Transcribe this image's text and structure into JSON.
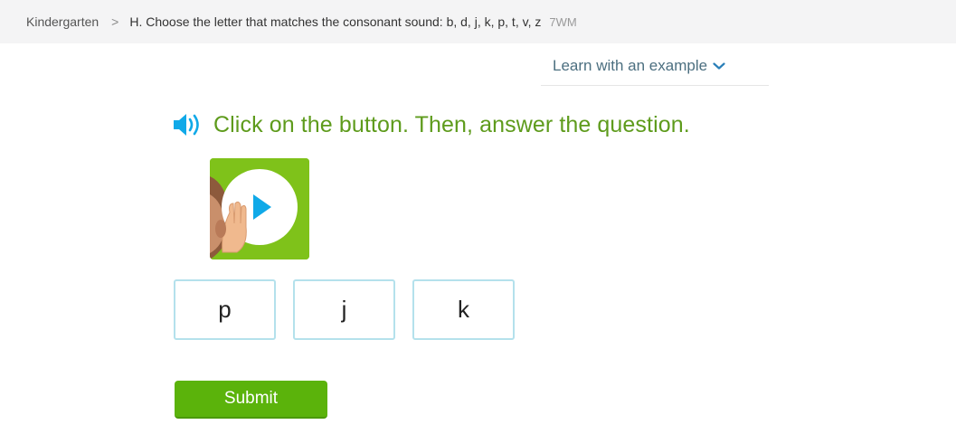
{
  "breadcrumb": {
    "grade": "Kindergarten",
    "separator": ">",
    "skill_title": "H. Choose the letter that matches the consonant sound: b, d, j, k, p, t, v, z",
    "skill_code": "7WM"
  },
  "learn_example": {
    "label": "Learn with an example",
    "icon": "chevron-down-icon"
  },
  "question": {
    "speaker_icon": "speaker-icon",
    "text": "Click on the button. Then, answer the question."
  },
  "audio_button": {
    "icon": "play-icon",
    "illustration": "ear-listening-hand"
  },
  "choices": [
    "p",
    "j",
    "k"
  ],
  "submit": {
    "label": "Submit"
  },
  "colors": {
    "accent_green": "#5bb30b",
    "question_green": "#5e9b1c",
    "choice_border": "#b4e1ec",
    "play_blue": "#10a9e8"
  }
}
